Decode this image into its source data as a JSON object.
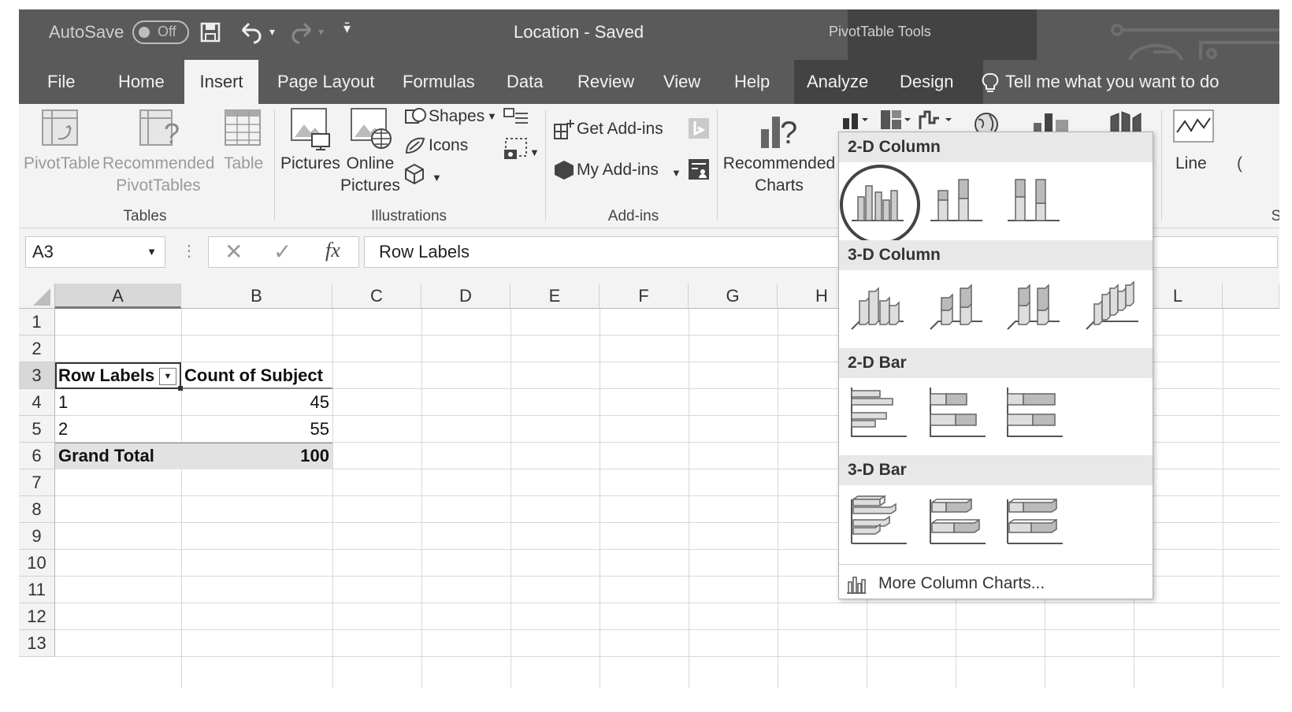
{
  "titlebar": {
    "autosave_label": "AutoSave",
    "autosave_state": "Off",
    "document_title": "Location  -  Saved",
    "contextual_group": "PivotTable Tools"
  },
  "tabs": [
    "File",
    "Home",
    "Insert",
    "Page Layout",
    "Formulas",
    "Data",
    "Review",
    "View",
    "Help",
    "Analyze",
    "Design"
  ],
  "active_tab": "Insert",
  "tell_me": "Tell me what you want to do",
  "ribbon": {
    "tables": {
      "label": "Tables",
      "pivottable": "PivotTable",
      "recommended_1": "Recommended",
      "recommended_2": "PivotTables",
      "table": "Table"
    },
    "illustrations": {
      "label": "Illustrations",
      "pictures": "Pictures",
      "online_1": "Online",
      "online_2": "Pictures",
      "shapes": "Shapes",
      "icons": "Icons"
    },
    "addins": {
      "label": "Add-ins",
      "get": "Get Add-ins",
      "my": "My Add-ins"
    },
    "charts": {
      "rec_1": "Recommended",
      "rec_2": "Charts",
      "line": "Line",
      "partial_label": "S"
    }
  },
  "formula_bar": {
    "namebox": "A3",
    "fx": "fx",
    "formula": "Row Labels"
  },
  "columns": [
    "A",
    "B",
    "C",
    "D",
    "E",
    "F",
    "G",
    "H",
    "L"
  ],
  "rows": [
    "1",
    "2",
    "3",
    "4",
    "5",
    "6",
    "7",
    "8",
    "9",
    "10",
    "11",
    "12",
    "13"
  ],
  "pivot": {
    "header_a": "Row Labels",
    "header_b": "Count of Subject",
    "r1_label": "1",
    "r1_value": "45",
    "r2_label": "2",
    "r2_value": "55",
    "total_label": "Grand Total",
    "total_value": "100"
  },
  "dropdown": {
    "sections": [
      "2-D Column",
      "3-D Column",
      "2-D Bar",
      "3-D Bar"
    ],
    "more": "More Column Charts..."
  }
}
